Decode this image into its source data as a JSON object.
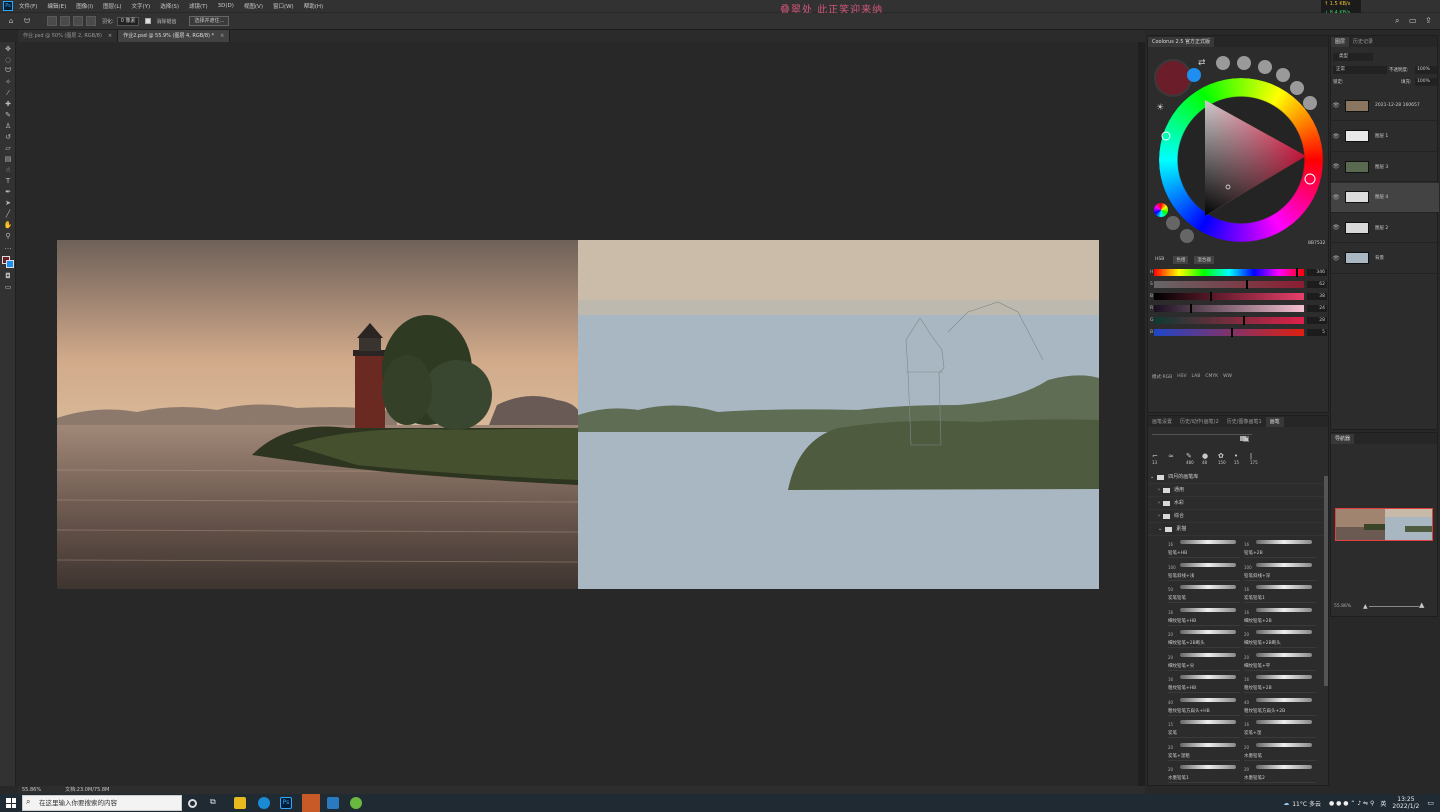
{
  "app": {
    "logo": "Ps",
    "menu": [
      "文件(F)",
      "编辑(E)",
      "图像(I)",
      "图层(L)",
      "文字(Y)",
      "选择(S)",
      "滤镜(T)",
      "3D(D)",
      "视图(V)",
      "窗口(W)",
      "帮助(H)"
    ],
    "banner_text": "叠翠处 此正笑迎来纳",
    "net_up": "↑ 1.5 KB/s",
    "net_down": "↓ 8.4 KB/s"
  },
  "options": {
    "feather_label": "羽化:",
    "feather_value": "0 像素",
    "antialias_label": "消除锯齿",
    "select_mask_button": "选择并遮住..."
  },
  "tabs": [
    {
      "label": "作业.psd @ 50% (图层 2, RGB/8)",
      "active": false
    },
    {
      "label": "作业2.psd @ 55.9% (图层 4, RGB/8) *",
      "active": true
    }
  ],
  "status": {
    "zoom": "55.86%",
    "doc_size": "文档:23.0M/75.8M"
  },
  "color_panel": {
    "title": "Coolorus 2.5 官方正式版",
    "primary_color": "#6b1d2a",
    "secondary_color": "#1e8ff0",
    "hex_label": "8B7532",
    "tabs": [
      "HSB",
      "色相",
      "混合器"
    ],
    "sliders": [
      {
        "label": "H",
        "value": "346",
        "pos": 0.96,
        "gradient": "linear-gradient(90deg,#f00,#ff0,#0f0,#0ff,#00f,#f0f,#f00)"
      },
      {
        "label": "S",
        "value": "62",
        "pos": 0.62,
        "gradient": "linear-gradient(90deg,#666,#8b1d32)"
      },
      {
        "label": "B",
        "value": "38",
        "pos": 0.38,
        "gradient": "linear-gradient(90deg,#000,#e8406a)"
      },
      {
        "label": "R",
        "value": "24",
        "pos": 0.24,
        "gradient": "linear-gradient(90deg,#1a1020,#f5c0d0)"
      },
      {
        "label": "G",
        "value": "28",
        "pos": 0.6,
        "gradient": "linear-gradient(90deg,#0c3a32,#e0204a)"
      },
      {
        "label": "B",
        "value": "5",
        "pos": 0.52,
        "gradient": "linear-gradient(90deg,#1e46c8,#e02010)"
      }
    ],
    "modes": [
      "模式:RGB",
      "HSV",
      "LAB",
      "CMYK",
      "WW"
    ]
  },
  "brush_panel": {
    "tabs": [
      "画笔设置",
      "历史/动作(画笔)2",
      "历史/图像画笔1",
      "画笔"
    ],
    "sizes": [
      "13",
      "",
      "480",
      "48",
      "150",
      "15",
      "175"
    ],
    "root_folder": "四月的画笔库",
    "folders": [
      "通用",
      "水彩",
      "综合",
      "素描"
    ],
    "brushes": [
      {
        "size": "16",
        "name": "铅笔+HB"
      },
      {
        "size": "16",
        "name": "铅笔+2B"
      },
      {
        "size": "100",
        "name": "铅笔斜线+浅"
      },
      {
        "size": "100",
        "name": "铅笔斜线+深"
      },
      {
        "size": "50",
        "name": "炭笔铅笔"
      },
      {
        "size": "16",
        "name": "炭笔铅笔1"
      },
      {
        "size": "16",
        "name": "细纹铅笔+HB"
      },
      {
        "size": "16",
        "name": "细纹铅笔+2B"
      },
      {
        "size": "20",
        "name": "细纹铅笔+2B断头"
      },
      {
        "size": "20",
        "name": "细纹铅笔+2B断头"
      },
      {
        "size": "20",
        "name": "细纹铅笔+尖"
      },
      {
        "size": "20",
        "name": "细纹铅笔+平"
      },
      {
        "size": "16",
        "name": "粗纹铅笔+HB"
      },
      {
        "size": "16",
        "name": "粗纹铅笔+2B"
      },
      {
        "size": "40",
        "name": "粗纹铅笔方扁头+HB"
      },
      {
        "size": "40",
        "name": "粗纹铅笔方扁头+2B"
      },
      {
        "size": "15",
        "name": "炭笔"
      },
      {
        "size": "16",
        "name": "炭笔+湿"
      },
      {
        "size": "20",
        "name": "炭笔+湿粗"
      },
      {
        "size": "20",
        "name": "水墨铅笔"
      },
      {
        "size": "20",
        "name": "水墨铅笔1"
      },
      {
        "size": "20",
        "name": "水墨铅笔2"
      }
    ]
  },
  "layers_panel": {
    "tabs": [
      "图层",
      "历史记录"
    ],
    "filter": "类型",
    "blend_mode": "正常",
    "opacity_label": "不透明度:",
    "opacity": "100%",
    "lock_label": "锁定:",
    "fill_label": "填充:",
    "fill": "100%",
    "layers": [
      {
        "name": "2021-12-28 160657",
        "thumb": "#8a7560",
        "selected": false
      },
      {
        "name": "图层 1",
        "thumb": "#e8e8e8",
        "selected": false
      },
      {
        "name": "图层 3",
        "thumb": "#5a6a50",
        "selected": false
      },
      {
        "name": "图层 4",
        "thumb": "#dcdcdc",
        "selected": true
      },
      {
        "name": "图层 2",
        "thumb": "#d8d8d8",
        "selected": false
      },
      {
        "name": "背景",
        "thumb": "#aab8c4",
        "selected": false
      }
    ]
  },
  "navigator": {
    "title": "导航器",
    "zoom": "55.86%"
  },
  "taskbar": {
    "search_placeholder": "在这里输入你要搜索的内容",
    "weather": "11°C 多云",
    "ime": "英",
    "time": "13:25",
    "date": "2022/1/2"
  }
}
